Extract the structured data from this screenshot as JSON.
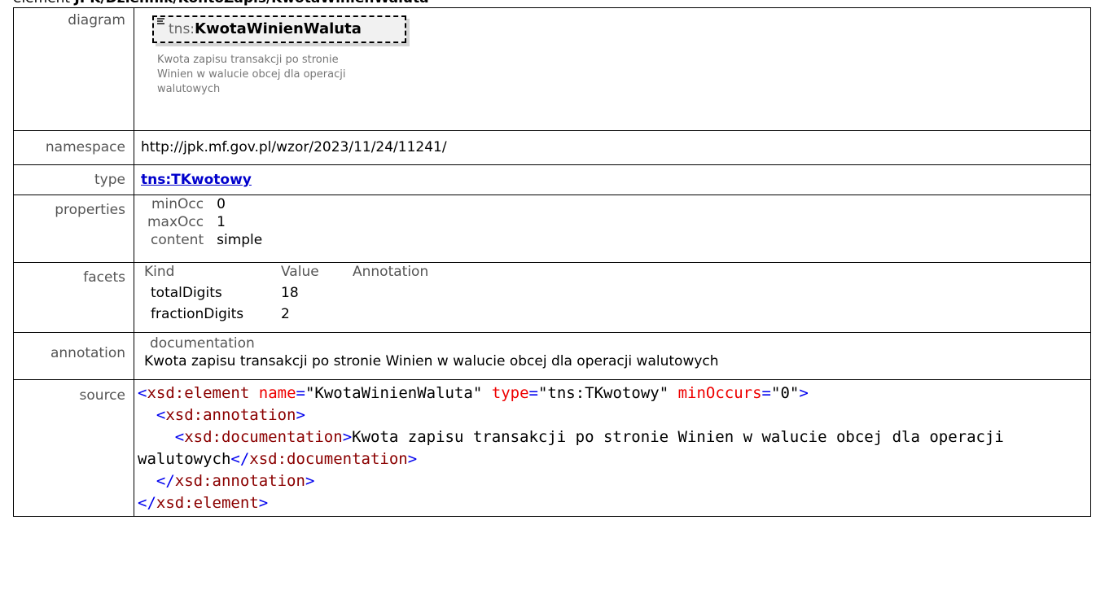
{
  "header": {
    "prefix": "element",
    "path": "JPK/Dziennik/KontoZapis/KwotaWinienWaluta"
  },
  "rows": {
    "diagram": {
      "label": "diagram",
      "ns_prefix": "tns:",
      "element_name": "KwotaWinienWaluta",
      "doc": "Kwota zapisu transakcji po stronie Winien w walucie obcej dla operacji walutowych"
    },
    "namespace": {
      "label": "namespace",
      "value": "http://jpk.mf.gov.pl/wzor/2023/11/24/11241/"
    },
    "type": {
      "label": "type",
      "value": "tns:TKwotowy"
    },
    "properties": {
      "label": "properties",
      "items": [
        {
          "key": "minOcc",
          "value": "0"
        },
        {
          "key": "maxOcc",
          "value": "1"
        },
        {
          "key": "content",
          "value": "simple"
        }
      ]
    },
    "facets": {
      "label": "facets",
      "headers": [
        "Kind",
        "Value",
        "Annotation"
      ],
      "items": [
        {
          "kind": "totalDigits",
          "value": "18",
          "annotation": ""
        },
        {
          "kind": "fractionDigits",
          "value": "2",
          "annotation": ""
        }
      ]
    },
    "annotation": {
      "label": "annotation",
      "heading": "documentation",
      "text": "Kwota zapisu transakcji po stronie Winien w walucie obcej dla operacji walutowych"
    },
    "source": {
      "label": "source",
      "lines": [
        "<xsd:element name=\"KwotaWinienWaluta\" type=\"tns:TKwotowy\" minOccurs=\"0\">",
        "  <xsd:annotation>",
        "    <xsd:documentation>Kwota zapisu transakcji po stronie Winien w walucie obcej dla operacji walutowych</xsd:documentation>",
        "  </xsd:annotation>",
        "</xsd:element>"
      ]
    }
  }
}
